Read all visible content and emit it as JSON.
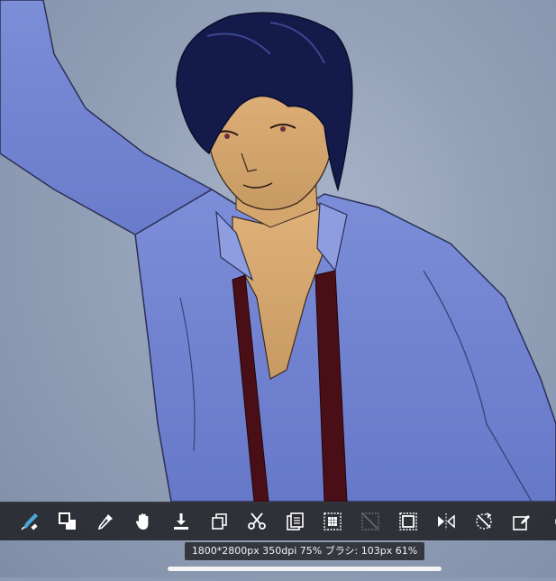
{
  "colors": {
    "toolbar_bg": "#26282c",
    "icon_color": "#ffffff",
    "accent_brush": "#4aa7d8",
    "disabled_icon": "#6d6f74"
  },
  "toolbar": {
    "tools": [
      {
        "icon": "brush-eraser-icon"
      },
      {
        "icon": "color-swap-icon"
      },
      {
        "icon": "eyedropper-icon"
      },
      {
        "icon": "hand-pan-icon"
      },
      {
        "icon": "import-download-icon"
      },
      {
        "icon": "duplicate-icon"
      },
      {
        "icon": "scissors-icon"
      },
      {
        "icon": "paste-icon"
      },
      {
        "icon": "grid-select-icon"
      },
      {
        "icon": "clear-selection-icon"
      },
      {
        "icon": "selection-marquee-icon"
      },
      {
        "icon": "flip-horizontal-icon"
      },
      {
        "icon": "rotate-icon"
      },
      {
        "icon": "edit-transform-icon"
      },
      {
        "icon": "more-icon"
      }
    ]
  },
  "status": {
    "text": "1800*2800px 350dpi 75% ブラシ: 103px 61%"
  }
}
